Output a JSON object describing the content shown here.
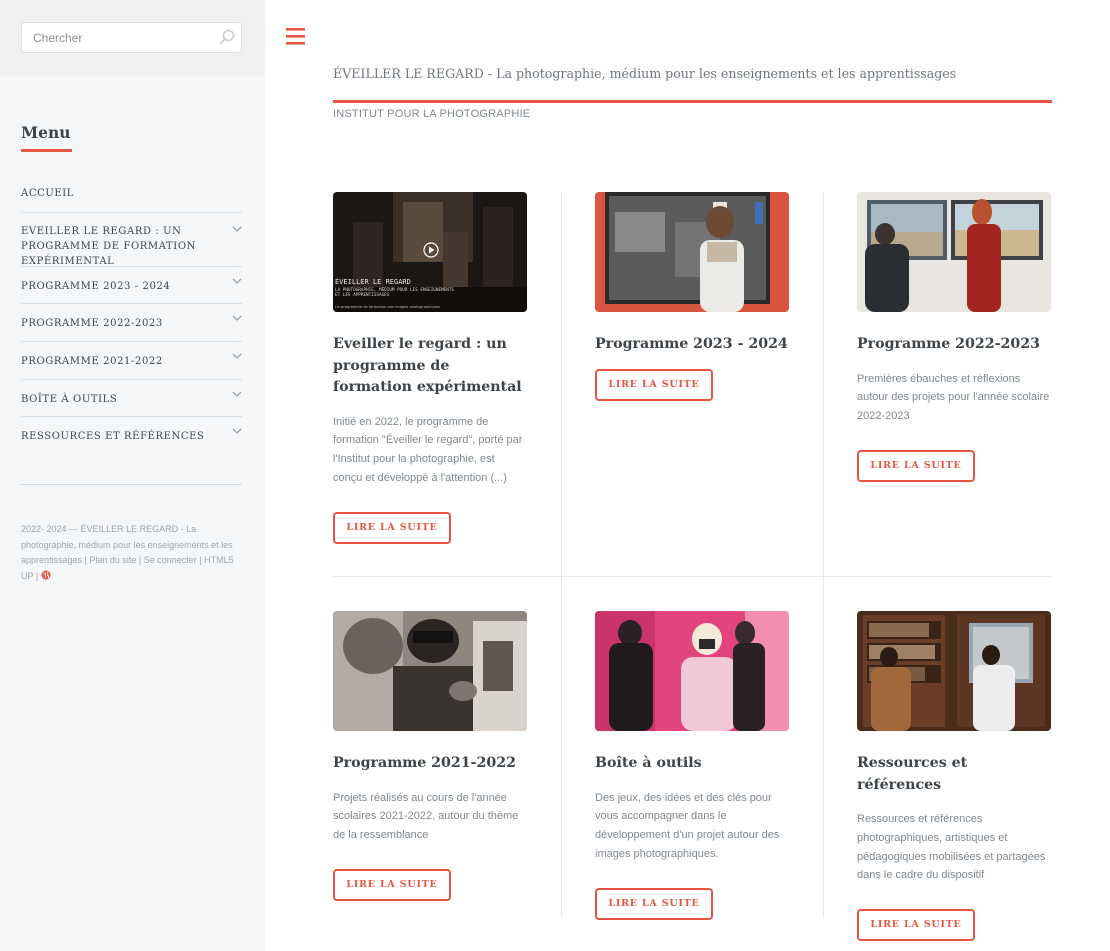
{
  "search": {
    "placeholder": "Chercher"
  },
  "sidebar": {
    "menu_title": "Menu",
    "items": [
      {
        "label": "ACCUEIL",
        "has_submenu": false
      },
      {
        "label": "EVEILLER LE REGARD : UN PROGRAMME DE FORMATION EXPÉRIMENTAL",
        "has_submenu": true
      },
      {
        "label": "PROGRAMME 2023 - 2024",
        "has_submenu": true
      },
      {
        "label": "PROGRAMME 2022-2023",
        "has_submenu": true
      },
      {
        "label": "PROGRAMME 2021-2022",
        "has_submenu": true
      },
      {
        "label": "BOÎTE À OUTILS",
        "has_submenu": true
      },
      {
        "label": "RESSOURCES ET RÉFÉRENCES",
        "has_submenu": true
      }
    ],
    "footer": {
      "years": "2022- 2024",
      "site_name": " — ÉVEILLER LE REGARD - La photographie, médium pour les enseignements et les apprentissages",
      "plan_link": "Plan du site",
      "login_link": "Se connecter",
      "html5up_link": "HTML5 UP",
      "separator": " | "
    }
  },
  "header": {
    "title": "ÉVEILLER LE REGARD - La photographie, médium pour les enseignements et les apprentissages",
    "subtitle": "INSTITUT POUR LA PHOTOGRAPHIE"
  },
  "video_overlay": {
    "line1": "ÉVEILLER LE REGARD",
    "line2": "LA PHOTOGRAPHIE, MÉDIUM POUR LES ENSEIGNEMENTS",
    "line3": "ET LES APPRENTISSAGES",
    "line4": "Un programme de formation aux images photographiques"
  },
  "articles": [
    {
      "title": "Eveiller le regard : un programme de formation expérimental",
      "text": "Initié en 2022, le programme de formation \"Éveiller le regard\", porté par l'Institut pour la photographie, est conçu et développé à l'attention (...)",
      "button": "LIRE LA SUITE",
      "image": "video-thumbnail"
    },
    {
      "title": "Programme 2023 - 2024",
      "text": "",
      "button": "LIRE LA SUITE",
      "image": "poster-photo"
    },
    {
      "title": "Programme 2022-2023",
      "text": "Premières ébauches et réflexions autour des projets pour l'année scolaire 2022-2023",
      "button": "LIRE LA SUITE",
      "image": "gallery-photo"
    },
    {
      "title": "Programme 2021-2022",
      "text": "Projets réalisés au cours de l'année scolaires 2021-2022, autour du thème de la ressemblance",
      "button": "LIRE LA SUITE",
      "image": "portrait-photo"
    },
    {
      "title": "Boîte à outils",
      "text": "Des jeux, des idées et des clés pour vous accompagner dans le développement d'un projet autour des images photographiques.",
      "button": "LIRE LA SUITE",
      "image": "mirror-photo"
    },
    {
      "title": "Ressources et références",
      "text": "Ressources et références photographiques, artistiques et pédagogiques mobilisées et partagées dans le cadre du dispositif",
      "button": "LIRE LA SUITE",
      "image": "library-photo"
    }
  ],
  "colors": {
    "accent": "#e45641",
    "sidebar_bg": "#f5f6f7",
    "text": "#3d4449",
    "muted": "#7f888f"
  }
}
